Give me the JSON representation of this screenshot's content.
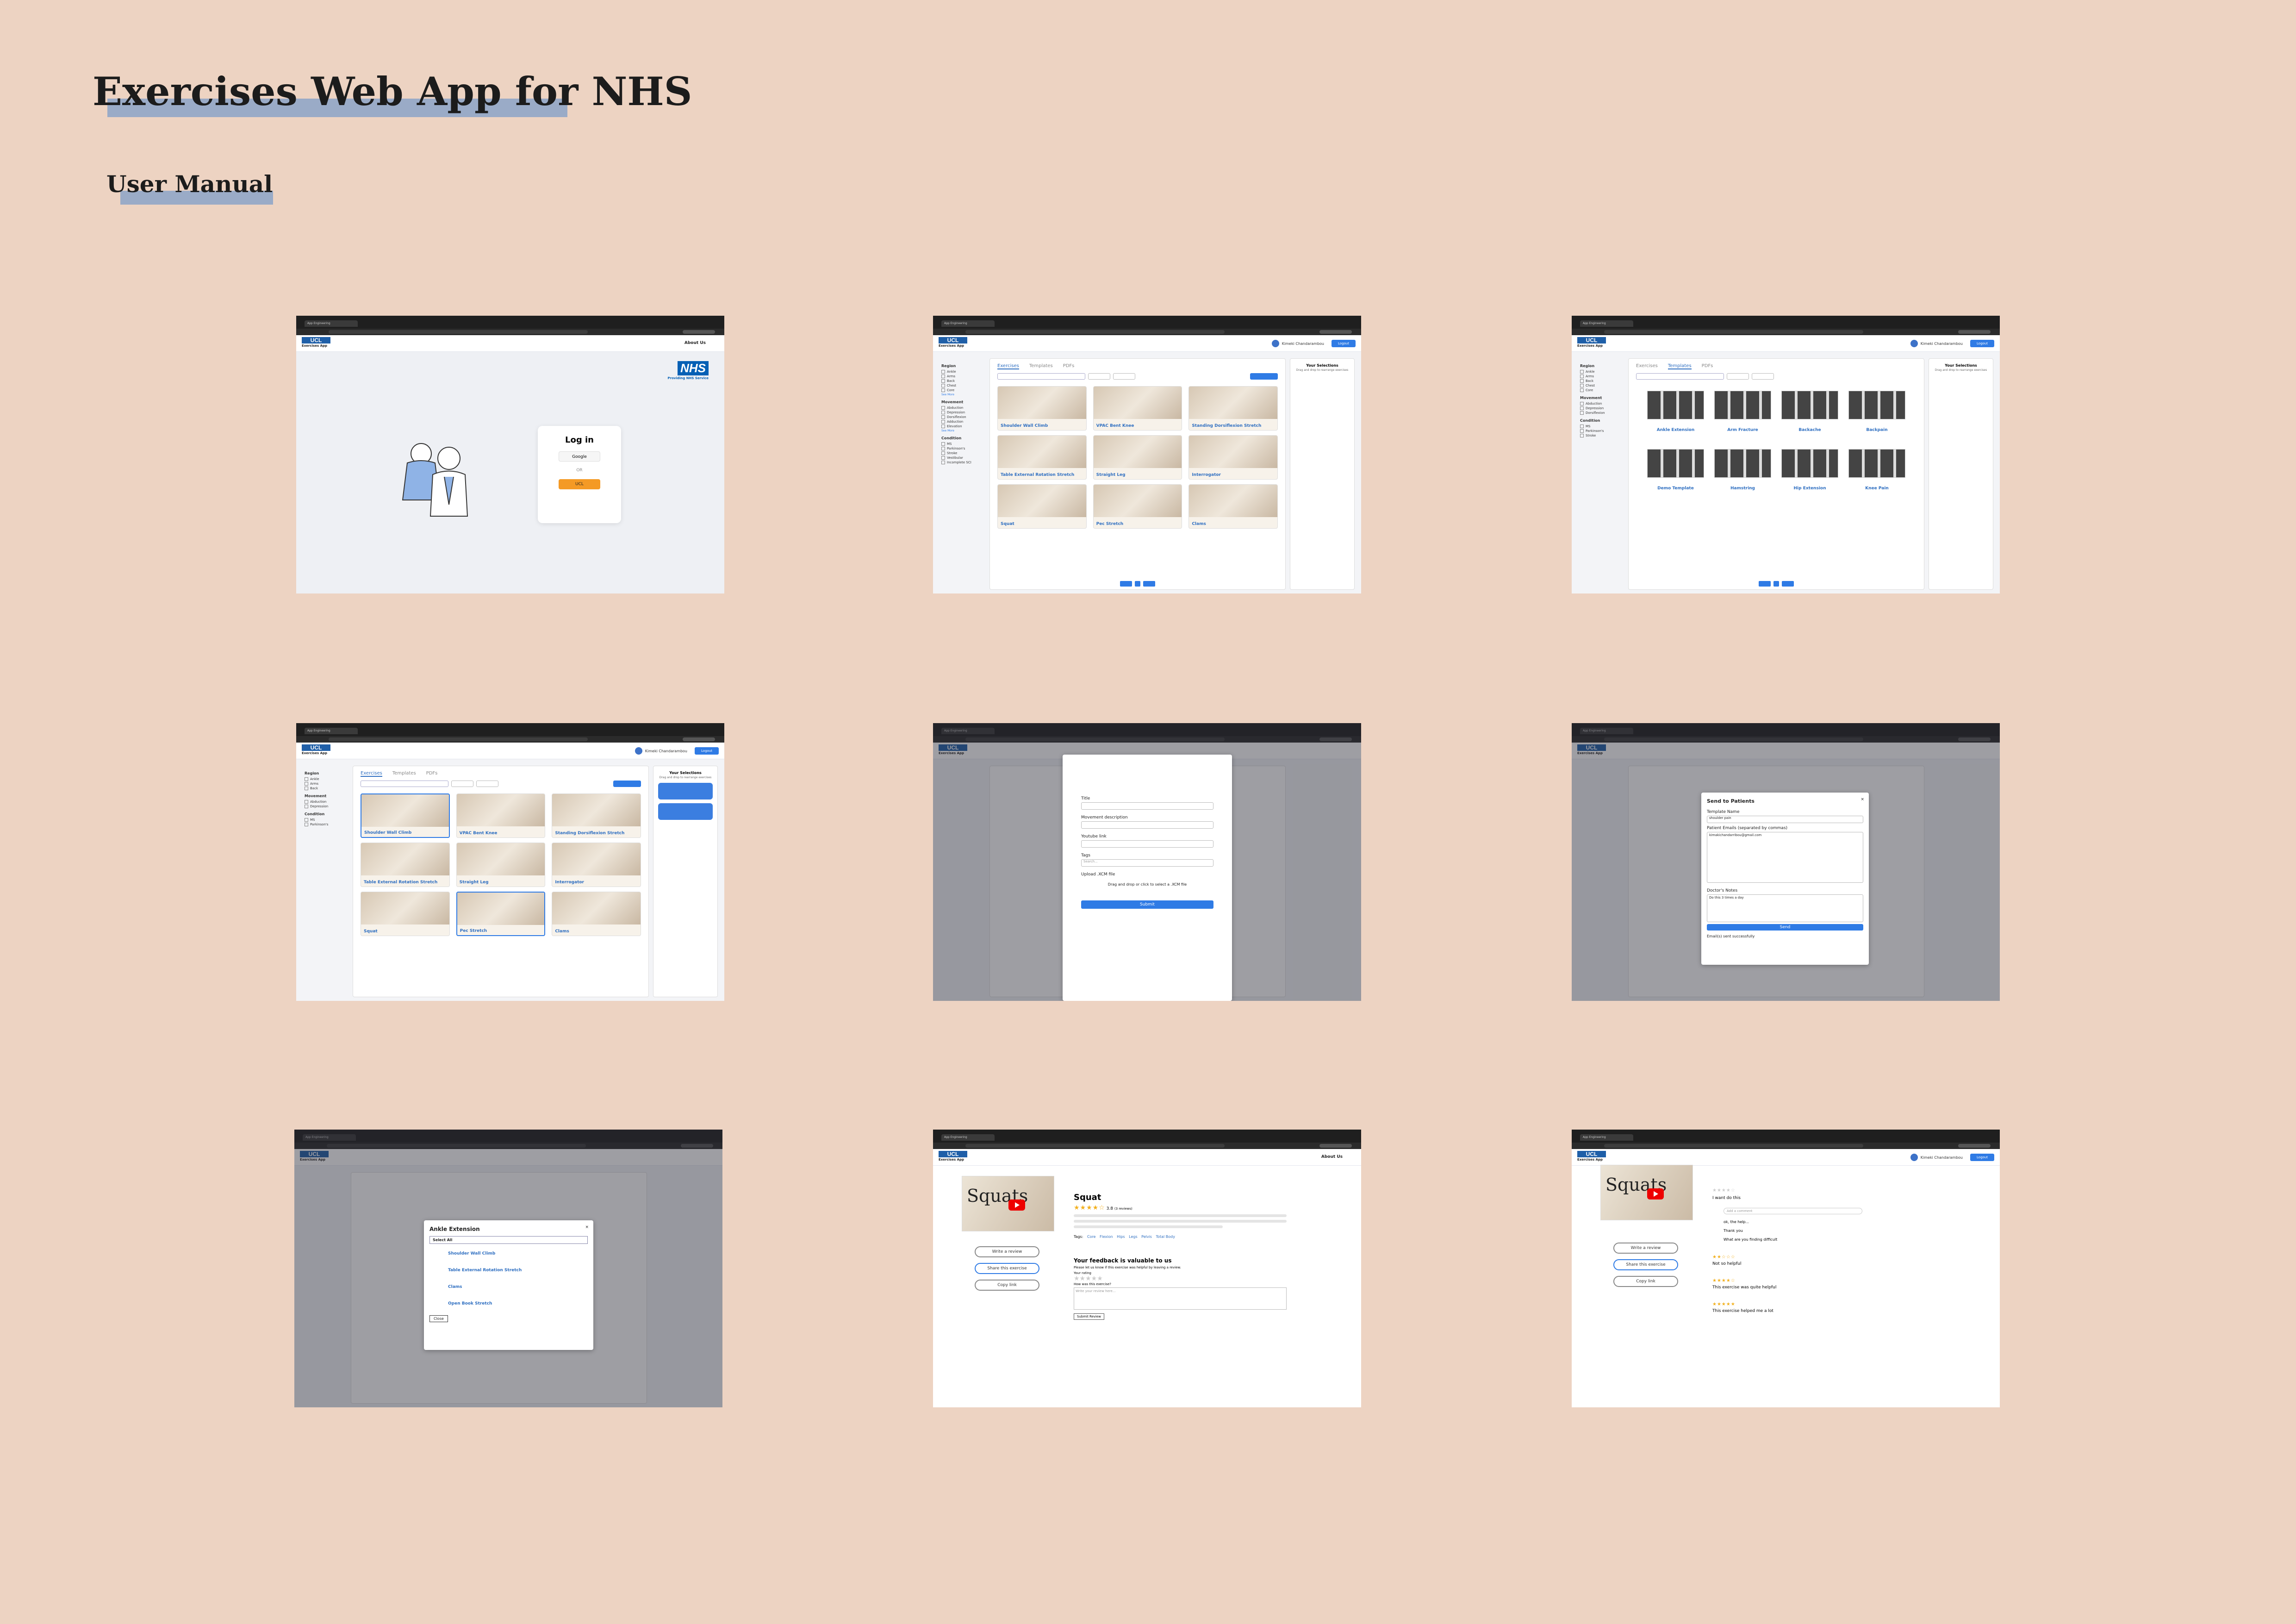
{
  "header": {
    "title": "Exercises Web App for NHS",
    "subtitle": "User Manual"
  },
  "common": {
    "browser_tab": "App Engineering",
    "logo_mark": "UCL",
    "logo_text": "Exercises App",
    "about": "About Us",
    "user_name": "Kimeki Chandarambou",
    "logout": "Logout"
  },
  "login": {
    "title": "Log in",
    "google": "Google",
    "or": "OR",
    "ucl_btn": "UCL",
    "nhs_badge": "NHS",
    "nhs_tag": "Providing NHS Service"
  },
  "sidebar": {
    "region_title": "Region",
    "region": [
      "Ankle",
      "Arms",
      "Back",
      "Chest",
      "Core"
    ],
    "movement_title": "Movement",
    "movement": [
      "Abduction",
      "Depression",
      "Dorsiflexion",
      "Adduction",
      "Elevation"
    ],
    "condition_title": "Condition",
    "condition": [
      "MS",
      "Parkinson's",
      "Stroke",
      "Vestibular",
      "Incomplete SCI"
    ],
    "see_more": "See More"
  },
  "tabs": [
    "Exercises",
    "Templates",
    "PDFs"
  ],
  "selections": {
    "title": "Your Selections",
    "hint": "Drag and drop to rearrange exercises"
  },
  "exercises": [
    "Shoulder Wall Climb",
    "VPAC Bent Knee",
    "Standing Dorsiflexion Stretch",
    "Table External Rotation Stretch",
    "Straight Leg",
    "Interrogator",
    "Squat",
    "Pec Stretch",
    "Clams"
  ],
  "templates": [
    "Ankle Extension",
    "Arm Fracture",
    "Backache",
    "Backpain",
    "Demo Template",
    "Hamstring",
    "Hip Extension",
    "Knee Pain"
  ],
  "upload_form": {
    "title": "Title",
    "description": "Movement description",
    "youtube": "Youtube link",
    "tags": "Tags",
    "tags_placeholder": "Search...",
    "upload": "Upload .XCM file",
    "drop": "Drag and drop or click to select a .XCM file",
    "submit": "Submit"
  },
  "send": {
    "title": "Send to Patients",
    "template_label": "Template Name",
    "template_value": "shoulder pain",
    "emails_label": "Patient Emails (separated by commas)",
    "emails_value": "kimakichandarribou@gmail.com",
    "notes_label": "Doctor's Notes",
    "notes_value": "Do this 3 times a day",
    "send": "Send",
    "success": "Email(s) sent successfully"
  },
  "template_modal": {
    "title": "Ankle Extension",
    "select_all": "Select All",
    "items": [
      "Shoulder Wall Climb",
      "Table External Rotation Stretch",
      "Clams",
      "Open Book Stretch"
    ],
    "close": "Close"
  },
  "detail": {
    "name": "Squat",
    "rating": "3.8",
    "rating_count": "(3 reviews)",
    "image_text": "Squats",
    "write_review": "Write a review",
    "share": "Share this exercise",
    "copy": "Copy link",
    "tags_label": "Tags:",
    "tags": [
      "Core",
      "Flexion",
      "Hips",
      "Legs",
      "Pelvis",
      "Total Body"
    ],
    "feedback_title": "Your feedback is valuable to us",
    "feedback_sub": "Please let us know if this exercise was helpful by leaving a review.",
    "your_rating": "Your rating",
    "how_was": "How was this exercise?",
    "placeholder": "Write your review here...",
    "submit_review": "Submit Review"
  },
  "reviews": {
    "add_comment": "Add a comment",
    "comments": [
      "I want do this",
      "ok, the help...",
      "Thank you",
      "What are you finding difficult",
      "Not so helpful",
      "This exercise was quite helpful",
      "This exercise helped me a lot"
    ]
  },
  "colors": {
    "background": "#edd3c2",
    "accent_bar": "#9aabc7",
    "primary": "#2f7be5",
    "brand": "#1f5fa8"
  }
}
